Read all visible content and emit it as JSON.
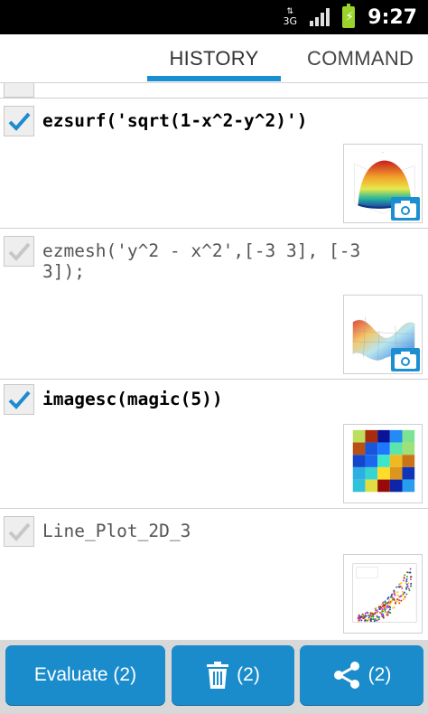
{
  "status_bar": {
    "network": "3G",
    "time": "9:27"
  },
  "tabs": {
    "history": "HISTORY",
    "command": "COMMAND",
    "selected": "history"
  },
  "history": [
    {
      "command": "ezsurf('sqrt(1-x^2-y^2)')",
      "checked": true,
      "active": true,
      "thumbnail": "surface-plot-thumbnail",
      "has_camera": true
    },
    {
      "command": "ezmesh('y^2 - x^2',[-3 3], [-3 3]);",
      "checked": true,
      "active": false,
      "thumbnail": "mesh-plot-thumbnail",
      "has_camera": true
    },
    {
      "command": "imagesc(magic(5))",
      "checked": true,
      "active": true,
      "thumbnail": "image-plot-thumbnail",
      "has_camera": false
    },
    {
      "command": "Line_Plot_2D_3",
      "checked": true,
      "active": false,
      "thumbnail": "scatter-plot-thumbnail",
      "has_camera": false
    }
  ],
  "bottom_bar": {
    "evaluate_label": "Evaluate (2)",
    "delete_count": "(2)",
    "share_count": "(2)"
  },
  "colors": {
    "accent": "#1a8ccc",
    "tab_underline": "#1a8fd0",
    "battery": "#9ad42a"
  },
  "icons": {
    "check": "checkmark-icon",
    "camera": "camera-icon",
    "delete": "trash-icon",
    "share": "share-icon"
  }
}
